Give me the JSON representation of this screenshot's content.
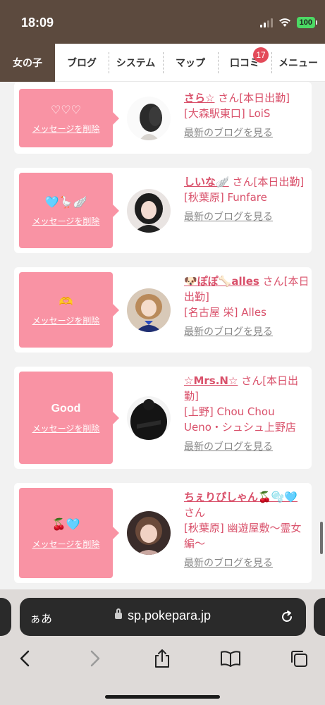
{
  "status": {
    "time": "18:09",
    "battery": "100"
  },
  "nav": {
    "tabs": [
      {
        "label": "女の子",
        "active": true
      },
      {
        "label": "ブログ"
      },
      {
        "label": "システム"
      },
      {
        "label": "マップ"
      },
      {
        "label": "口コミ",
        "badge": "17"
      },
      {
        "label": "メニュー"
      }
    ]
  },
  "cards": [
    {
      "message": "♡♡♡",
      "delete_label": "メッセージを削除",
      "name": "さら☆",
      "details": "さん[本日出勤]",
      "shop": "[大森駅東口] LoiS",
      "blog_link": "最新のブログを見る"
    },
    {
      "message": "🩵🪿🪽",
      "delete_label": "メッセージを削除",
      "name": "しいな🪽",
      "details": "さん[本日出勤]",
      "shop": "[秋葉原] Funfare",
      "blog_link": "最新のブログを見る"
    },
    {
      "message": "🫶",
      "delete_label": "メッセージを削除",
      "name": "🐶ぽぽ🦴alles",
      "details": "さん[本日出勤]",
      "shop": "[名古屋 栄] Alles",
      "blog_link": "最新のブログを見る"
    },
    {
      "message": "Good",
      "delete_label": "メッセージを削除",
      "name": "☆Mrs.N☆",
      "details": "さん[本日出勤]",
      "shop": "[上野] Chou Chou Ueno・シュシュ上野店",
      "blog_link": "最新のブログを見る"
    },
    {
      "message": "🍒🩵",
      "delete_label": "メッセージを削除",
      "name": "ちぇりぴしゃん🍒🫧🩵",
      "details": "さん",
      "shop": "[秋葉原] 幽遊屋敷〜霊女編〜",
      "blog_link": "最新のブログを見る"
    }
  ],
  "browser": {
    "aa_label": "ぁあ",
    "url": "sp.pokepara.jp"
  },
  "colors": {
    "header_brown": "#5c4a3e",
    "bubble_pink": "#f993a4",
    "text_pink": "#d9506a",
    "badge_red": "#e34b5a"
  }
}
